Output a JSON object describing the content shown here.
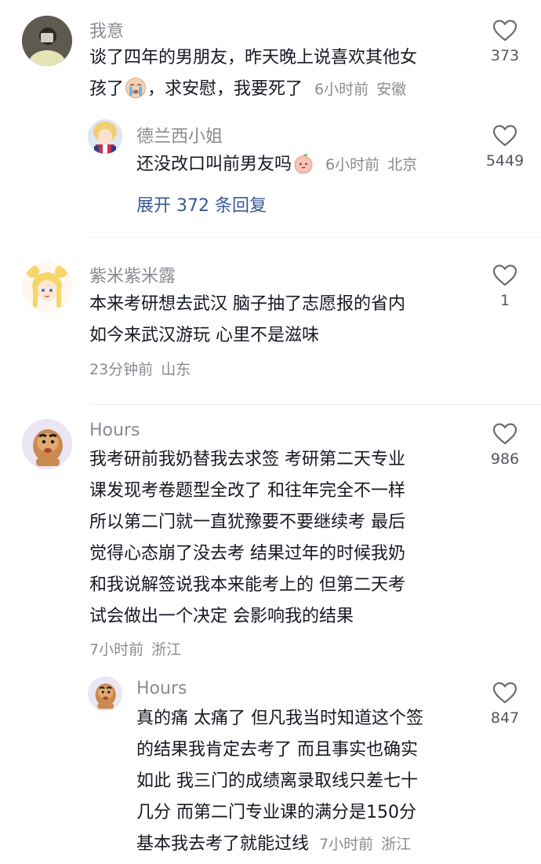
{
  "comments": [
    {
      "username": "我意",
      "lines": [
        "谈了四年的男朋友，昨天晚上说喜欢其他女",
        "孩了"
      ],
      "line2_after_emoji": "，求安慰，我要死了",
      "emoji": "crying-face",
      "time": "6小时前",
      "location": "安徽",
      "likes": "373",
      "reply": {
        "username": "德兰西小姐",
        "text": "还没改口叫前男友吗",
        "emoji": "peach-face",
        "time": "6小时前",
        "location": "北京",
        "likes": "5449"
      },
      "expand_label": "展开 372 条回复"
    },
    {
      "username": "紫米紫米露",
      "lines": [
        "本来考研想去武汉 脑子抽了志愿报的省内",
        "如今来武汉游玩 心里不是滋味"
      ],
      "time": "23分钟前",
      "location": "山东",
      "likes": "1"
    },
    {
      "username": "Hours",
      "lines": [
        "我考研前我奶替我去求签 考研第二天专业",
        "课发现考卷题型全改了 和往年完全不一样",
        "所以第二门就一直犹豫要不要继续考 最后",
        "觉得心态崩了没去考 结果过年的时候我奶",
        "和我说解签说我本来能考上的 但第二天考",
        "试会做出一个决定 会影响我的结果"
      ],
      "time": "7小时前",
      "location": "浙江",
      "likes": "986",
      "reply": {
        "username": "Hours",
        "lines": [
          "真的痛 太痛了 但凡我当时知道这个签",
          "的结果我肯定去考了 而且事实也确实",
          "如此 我三门的成绩离录取线只差七十",
          "几分 而第二门专业课的满分是150分",
          "基本我去考了就能过线"
        ],
        "time": "7小时前",
        "location": "浙江",
        "likes": "847"
      }
    }
  ]
}
